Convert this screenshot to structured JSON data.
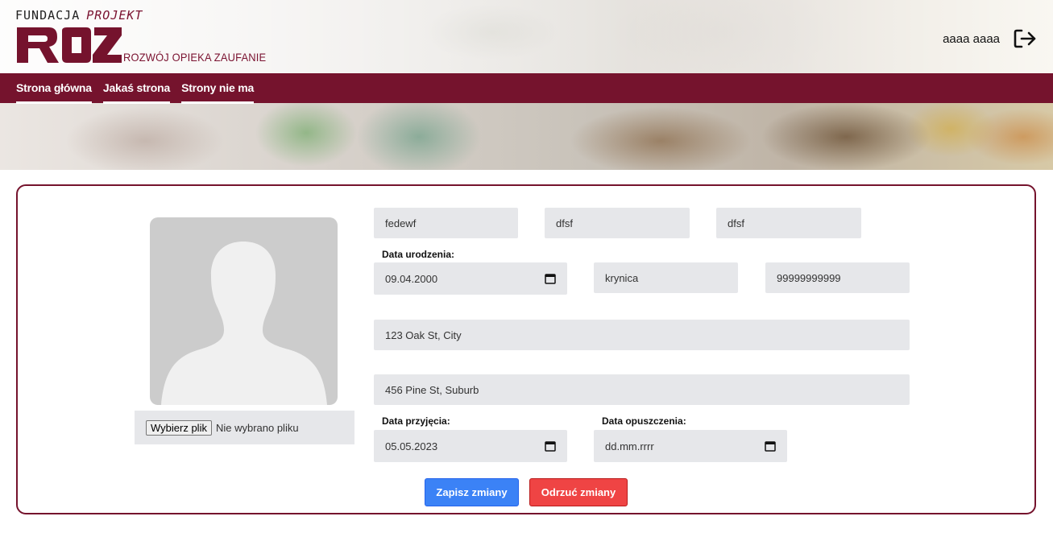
{
  "brand": {
    "top_left": "FUNDACJA",
    "top_right": "PROJEKT",
    "mark": "ROZ",
    "tagline": "ROZWÓJ OPIEKA ZAUFANIE",
    "accent_color": "#75132d"
  },
  "user": {
    "name": "aaaa aaaa",
    "logout_icon": "logout-icon"
  },
  "nav": {
    "items": [
      {
        "label": "Strona główna"
      },
      {
        "label": "Jakaś strona"
      },
      {
        "label": "Strony nie ma"
      }
    ]
  },
  "profile": {
    "avatar_icon": "person-silhouette-icon",
    "file_button": "Wybierz plik",
    "file_status": "Nie wybrano pliku"
  },
  "form": {
    "first_name": "fedewf",
    "middle_name": "dfsf",
    "last_name": "dfsf",
    "birth_date_label": "Data urodzenia:",
    "birth_date": "09.04.2000",
    "birth_place": "krynica",
    "phone": "99999999999",
    "address_1": "123 Oak St, City",
    "address_2": "456 Pine St, Suburb",
    "admission_date_label": "Data przyjęcia:",
    "admission_date": "05.05.2023",
    "leave_date_label": "Data opuszczenia:",
    "leave_date_placeholder": "dd.mm.rrrr"
  },
  "actions": {
    "save_label": "Zapisz zmiany",
    "cancel_label": "Odrzuć zmiany",
    "save_color": "#3b82f6",
    "cancel_color": "#ef4444"
  }
}
